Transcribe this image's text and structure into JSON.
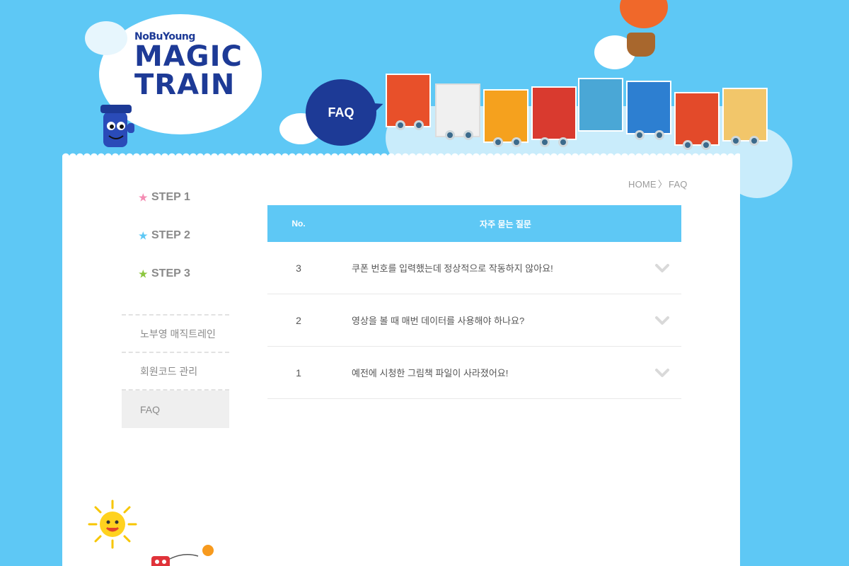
{
  "brand": {
    "name": "NoBuYoung",
    "line1": "MAGIC",
    "line2": "TRAIN"
  },
  "header": {
    "bubble_label": "FAQ"
  },
  "sidebar": {
    "steps": [
      {
        "label": "STEP 1",
        "star_color": "#f48cb3"
      },
      {
        "label": "STEP 2",
        "star_color": "#5ec8f5"
      },
      {
        "label": "STEP 3",
        "star_color": "#8cc63f"
      }
    ],
    "menu": [
      {
        "label": "노부영 매직트레인",
        "active": false
      },
      {
        "label": "회원코드 관리",
        "active": false
      },
      {
        "label": "FAQ",
        "active": true
      }
    ]
  },
  "breadcrumb": {
    "home": "HOME",
    "separator": "〉",
    "current": "FAQ"
  },
  "faq": {
    "headers": {
      "no": "No.",
      "question": "자주 묻는 질문"
    },
    "rows": [
      {
        "no": "3",
        "question": "쿠폰 번호를 입력했는데 정상적으로 작동하지 않아요!"
      },
      {
        "no": "2",
        "question": "영상을 볼 때 매번 데이터를 사용해야 하나요?"
      },
      {
        "no": "1",
        "question": "예전에 시청한 그림책 파일이 사라졌어요!"
      }
    ]
  },
  "colors": {
    "sky": "#5ec8f5",
    "navy": "#1d3a96",
    "chevron": "#d9d9d9"
  }
}
